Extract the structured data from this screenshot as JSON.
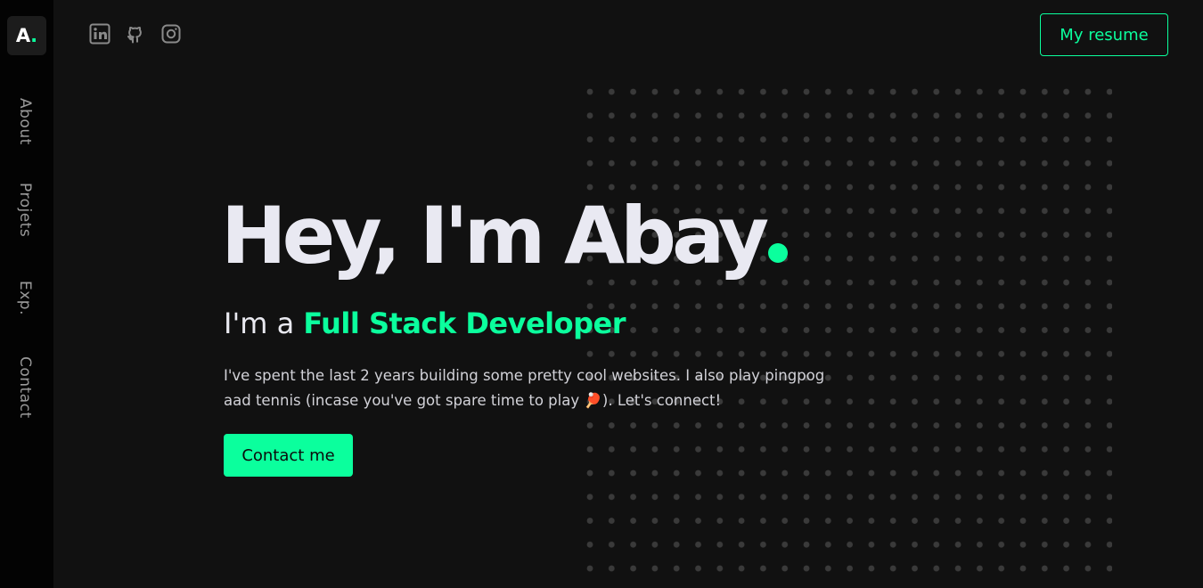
{
  "sidebar": {
    "logo_letter": "A",
    "logo_dot": ".",
    "nav": [
      {
        "label": "About"
      },
      {
        "label": "Projets"
      },
      {
        "label": "Exp."
      },
      {
        "label": "Contact"
      }
    ]
  },
  "header": {
    "social_icons": [
      "linkedin-icon",
      "github-icon",
      "instagram-icon"
    ],
    "resume_label": "My resume"
  },
  "hero": {
    "title": "Hey, I'm Abay",
    "subtitle_prefix": "I'm a ",
    "subtitle_role": "Full Stack Developer",
    "bio_before_emoji": "I've spent the last 2 years building some pretty cool websites. I also play pingpog aad tennis (incase you've got spare time to play ",
    "bio_emoji": "🏓",
    "bio_after_emoji": "). Let's connect!",
    "contact_label": "Contact me"
  },
  "colors": {
    "accent": "#0bff9d",
    "background": "#111111",
    "sidebar": "#030303",
    "text": "#e9e9f0"
  }
}
